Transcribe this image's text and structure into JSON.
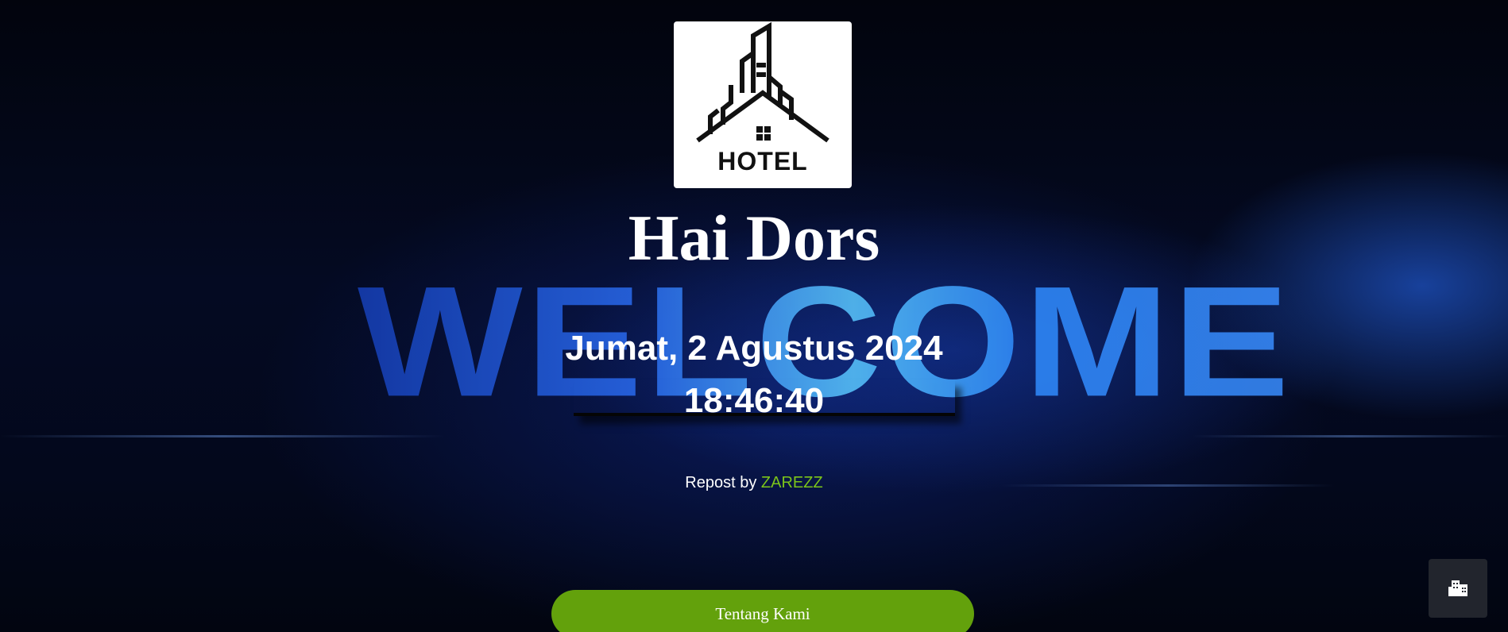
{
  "logo": {
    "text": "HOTEL",
    "icon": "hotel-building-icon"
  },
  "site_title": "Hai Dors",
  "background": {
    "word": "WELCOME"
  },
  "date": "Jumat, 2 Agustus 2024",
  "time": "18:46:40",
  "credit": {
    "prefix": "Repost by",
    "author": "ZAREZZ"
  },
  "about_button": {
    "label": "Tentang Kami"
  },
  "corner_button": {
    "icon": "building-icon"
  },
  "colors": {
    "accent_green": "#63a10c",
    "author_green": "#7bc41a",
    "welcome_blue": "#2a6cf0"
  }
}
